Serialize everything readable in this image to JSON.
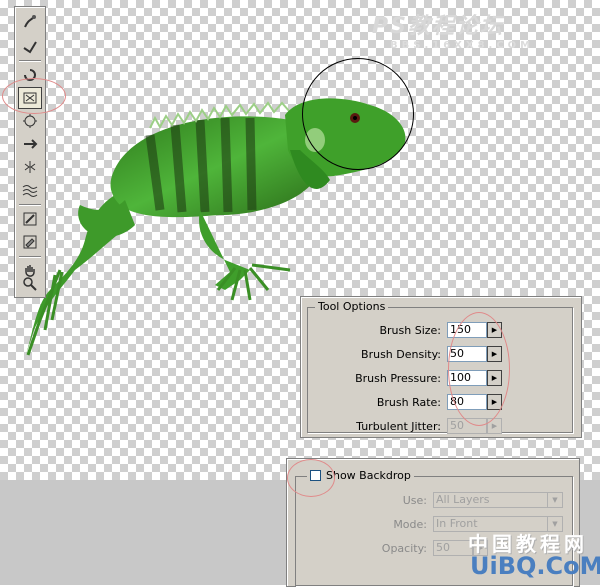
{
  "watermark": {
    "top_line1": "PS教程论坛",
    "top_line2": "BBS.16XX8.COM",
    "bottom_line1": "中国教程网",
    "bottom_line2": "UiBQ.CoM"
  },
  "toolbar": {
    "tools": [
      "warp-tool",
      "reconstruct-tool",
      "twirl-tool",
      "pucker-tool",
      "bloat-tool",
      "shift-pixels-tool",
      "reflection-tool",
      "turbulence-tool",
      "freeze-mask-tool",
      "thaw-mask-tool",
      "hand-tool",
      "zoom-tool"
    ],
    "active": "pucker-tool"
  },
  "tool_options": {
    "title": "Tool Options",
    "brush_size": {
      "label": "Brush Size:",
      "value": "150"
    },
    "brush_density": {
      "label": "Brush Density:",
      "value": "50"
    },
    "brush_pressure": {
      "label": "Brush Pressure:",
      "value": "100"
    },
    "brush_rate": {
      "label": "Brush Rate:",
      "value": "80"
    },
    "turbulent_jitter": {
      "label": "Turbulent Jitter:",
      "value": "50"
    }
  },
  "backdrop": {
    "show_label": "Show Backdrop",
    "show_checked": false,
    "use_label": "Use:",
    "use_value": "All Layers",
    "mode_label": "Mode:",
    "mode_value": "In Front",
    "opacity_label": "Opacity:",
    "opacity_value": "50"
  },
  "colors": {
    "panel": "#d4d0c8",
    "highlight_ellipse": "#e08a8a",
    "iguana_green": "#3f9a2a"
  }
}
